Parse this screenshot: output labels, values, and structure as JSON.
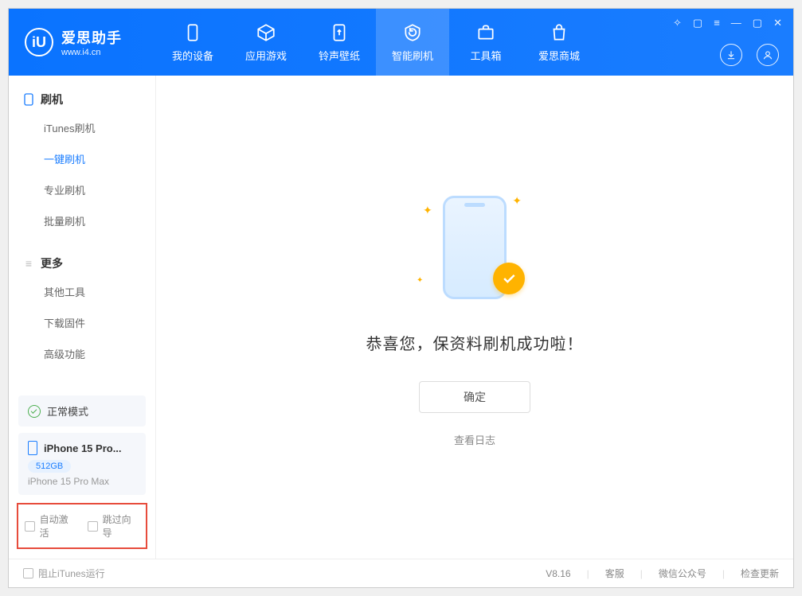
{
  "brand": {
    "name": "爱思助手",
    "url": "www.i4.cn",
    "logo_letter": "iU"
  },
  "nav": {
    "items": [
      {
        "label": "我的设备"
      },
      {
        "label": "应用游戏"
      },
      {
        "label": "铃声壁纸"
      },
      {
        "label": "智能刷机"
      },
      {
        "label": "工具箱"
      },
      {
        "label": "爱思商城"
      }
    ],
    "active_index": 3
  },
  "sidebar": {
    "groups": [
      {
        "title": "刷机",
        "items": [
          "iTunes刷机",
          "一键刷机",
          "专业刷机",
          "批量刷机"
        ],
        "active_index": 1
      },
      {
        "title": "更多",
        "items": [
          "其他工具",
          "下载固件",
          "高级功能"
        ],
        "active_index": -1
      }
    ],
    "mode_label": "正常模式",
    "device": {
      "name": "iPhone 15 Pro...",
      "storage": "512GB",
      "full": "iPhone 15 Pro Max"
    },
    "options": {
      "auto_activate": "自动激活",
      "skip_guide": "跳过向导"
    }
  },
  "main": {
    "success_text": "恭喜您，保资料刷机成功啦！",
    "ok_button": "确定",
    "view_log": "查看日志"
  },
  "footer": {
    "block_itunes": "阻止iTunes运行",
    "version": "V8.16",
    "links": [
      "客服",
      "微信公众号",
      "检查更新"
    ]
  }
}
